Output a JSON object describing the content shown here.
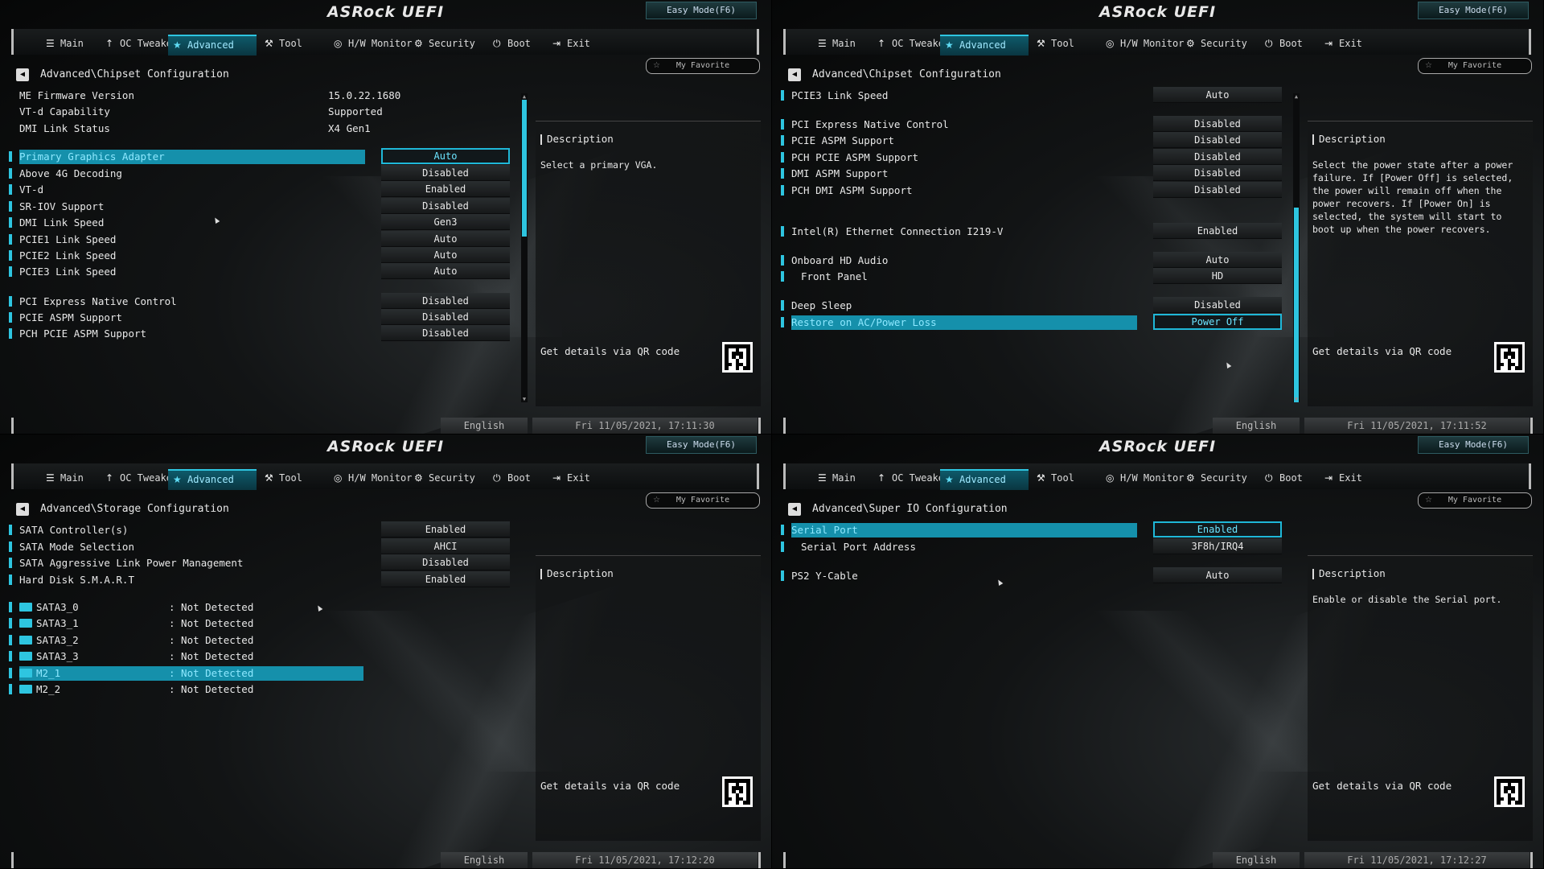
{
  "brand": "ASRock UEFI",
  "easy_mode": "Easy Mode(F6)",
  "my_favorite": "My Favorite",
  "menu": [
    {
      "label": "Main",
      "icon": "list-icon"
    },
    {
      "label": "OC Tweaker",
      "icon": "rocket-icon"
    },
    {
      "label": "Advanced",
      "icon": "star-icon"
    },
    {
      "label": "Tool",
      "icon": "tools-icon"
    },
    {
      "label": "H/W Monitor",
      "icon": "monitor-icon"
    },
    {
      "label": "Security",
      "icon": "shield-icon"
    },
    {
      "label": "Boot",
      "icon": "power-icon"
    },
    {
      "label": "Exit",
      "icon": "exit-icon"
    }
  ],
  "active_tab": "Advanced",
  "description_header": "Description",
  "qr_text": "Get details via QR code",
  "language": "English",
  "panels": [
    {
      "breadcrumb": "Advanced\\Chipset Configuration",
      "clock": "Fri 11/05/2021, 17:11:30",
      "description": "Select a primary VGA.",
      "info_rows": [
        {
          "label": "ME Firmware Version",
          "value": "15.0.22.1680"
        },
        {
          "label": "VT-d Capability",
          "value": "Supported"
        },
        {
          "label": "DMI Link Status",
          "value": "X4  Gen1"
        }
      ],
      "settings": [
        {
          "label": "Primary Graphics Adapter",
          "value": "Auto",
          "selected": true
        },
        {
          "label": "Above 4G Decoding",
          "value": "Disabled"
        },
        {
          "label": "VT-d",
          "value": "Enabled"
        },
        {
          "label": "SR-IOV Support",
          "value": "Disabled"
        },
        {
          "label": "DMI Link Speed",
          "value": "Gen3"
        },
        {
          "label": "PCIE1 Link Speed",
          "value": "Auto"
        },
        {
          "label": "PCIE2 Link Speed",
          "value": "Auto"
        },
        {
          "label": "PCIE3 Link Speed",
          "value": "Auto"
        },
        {
          "label": "PCI Express Native Control",
          "value": "Disabled"
        },
        {
          "label": "PCIE ASPM Support",
          "value": "Disabled"
        },
        {
          "label": "PCH PCIE ASPM Support",
          "value": "Disabled"
        }
      ]
    },
    {
      "breadcrumb": "Advanced\\Chipset Configuration",
      "clock": "Fri 11/05/2021, 17:11:52",
      "description": "Select the power state after a power failure. If [Power Off] is selected, the power will remain off when the power recovers. If [Power On] is selected, the system will start to boot up when the power recovers.",
      "settings": [
        {
          "label": "PCIE3 Link Speed",
          "value": "Auto"
        },
        {
          "label": "PCI Express Native Control",
          "value": "Disabled"
        },
        {
          "label": "PCIE ASPM Support",
          "value": "Disabled"
        },
        {
          "label": "PCH PCIE ASPM Support",
          "value": "Disabled"
        },
        {
          "label": "DMI ASPM Support",
          "value": "Disabled"
        },
        {
          "label": "PCH DMI ASPM Support",
          "value": "Disabled"
        },
        {
          "label": "Intel(R) Ethernet Connection I219-V",
          "value": "Enabled"
        },
        {
          "label": "Onboard HD Audio",
          "value": "Auto"
        },
        {
          "label": "Front Panel",
          "value": "HD"
        },
        {
          "label": "Deep Sleep",
          "value": "Disabled"
        },
        {
          "label": "Restore on AC/Power Loss",
          "value": "Power Off",
          "selected": true
        }
      ]
    },
    {
      "breadcrumb": "Advanced\\Storage Configuration",
      "clock": "Fri 11/05/2021, 17:12:20",
      "description": "",
      "settings": [
        {
          "label": "SATA Controller(s)",
          "value": "Enabled"
        },
        {
          "label": "SATA Mode Selection",
          "value": "AHCI"
        },
        {
          "label": "SATA Aggressive Link Power Management",
          "value": "Disabled"
        },
        {
          "label": "Hard Disk S.M.A.R.T",
          "value": "Enabled"
        }
      ],
      "devices": [
        {
          "label": "SATA3_0",
          "value": ": Not Detected"
        },
        {
          "label": "SATA3_1",
          "value": ": Not Detected"
        },
        {
          "label": "SATA3_2",
          "value": ": Not Detected"
        },
        {
          "label": "SATA3_3",
          "value": ": Not Detected"
        },
        {
          "label": "M2_1",
          "value": ": Not Detected",
          "selected": true
        },
        {
          "label": "M2_2",
          "value": ": Not Detected"
        }
      ]
    },
    {
      "breadcrumb": "Advanced\\Super IO Configuration",
      "clock": "Fri 11/05/2021, 17:12:27",
      "description": "Enable or disable the Serial port.",
      "settings": [
        {
          "label": "Serial Port",
          "value": "Enabled",
          "selected": true
        },
        {
          "label": "Serial Port Address",
          "value": "3F8h/IRQ4"
        },
        {
          "label": "PS2 Y-Cable",
          "value": "Auto"
        }
      ]
    }
  ]
}
